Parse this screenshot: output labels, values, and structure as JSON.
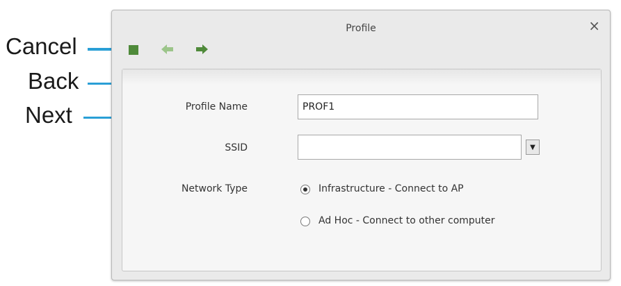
{
  "annotations": {
    "cancel": "Cancel",
    "back": "Back",
    "next": "Next",
    "line_color": "#2a9fd6"
  },
  "dialog": {
    "title": "Profile",
    "close_icon": "×"
  },
  "toolbar": {
    "cancel_icon": "stop-square-icon",
    "back_icon": "back-arrow-icon",
    "next_icon": "next-arrow-icon"
  },
  "form": {
    "profile_name_label": "Profile Name",
    "profile_name_value": "PROF1",
    "ssid_label": "SSID",
    "ssid_value": "",
    "network_type_label": "Network Type",
    "options": [
      {
        "label": "Infrastructure - Connect to AP",
        "selected": true
      },
      {
        "label": "Ad Hoc - Connect to other computer",
        "selected": false
      }
    ]
  }
}
